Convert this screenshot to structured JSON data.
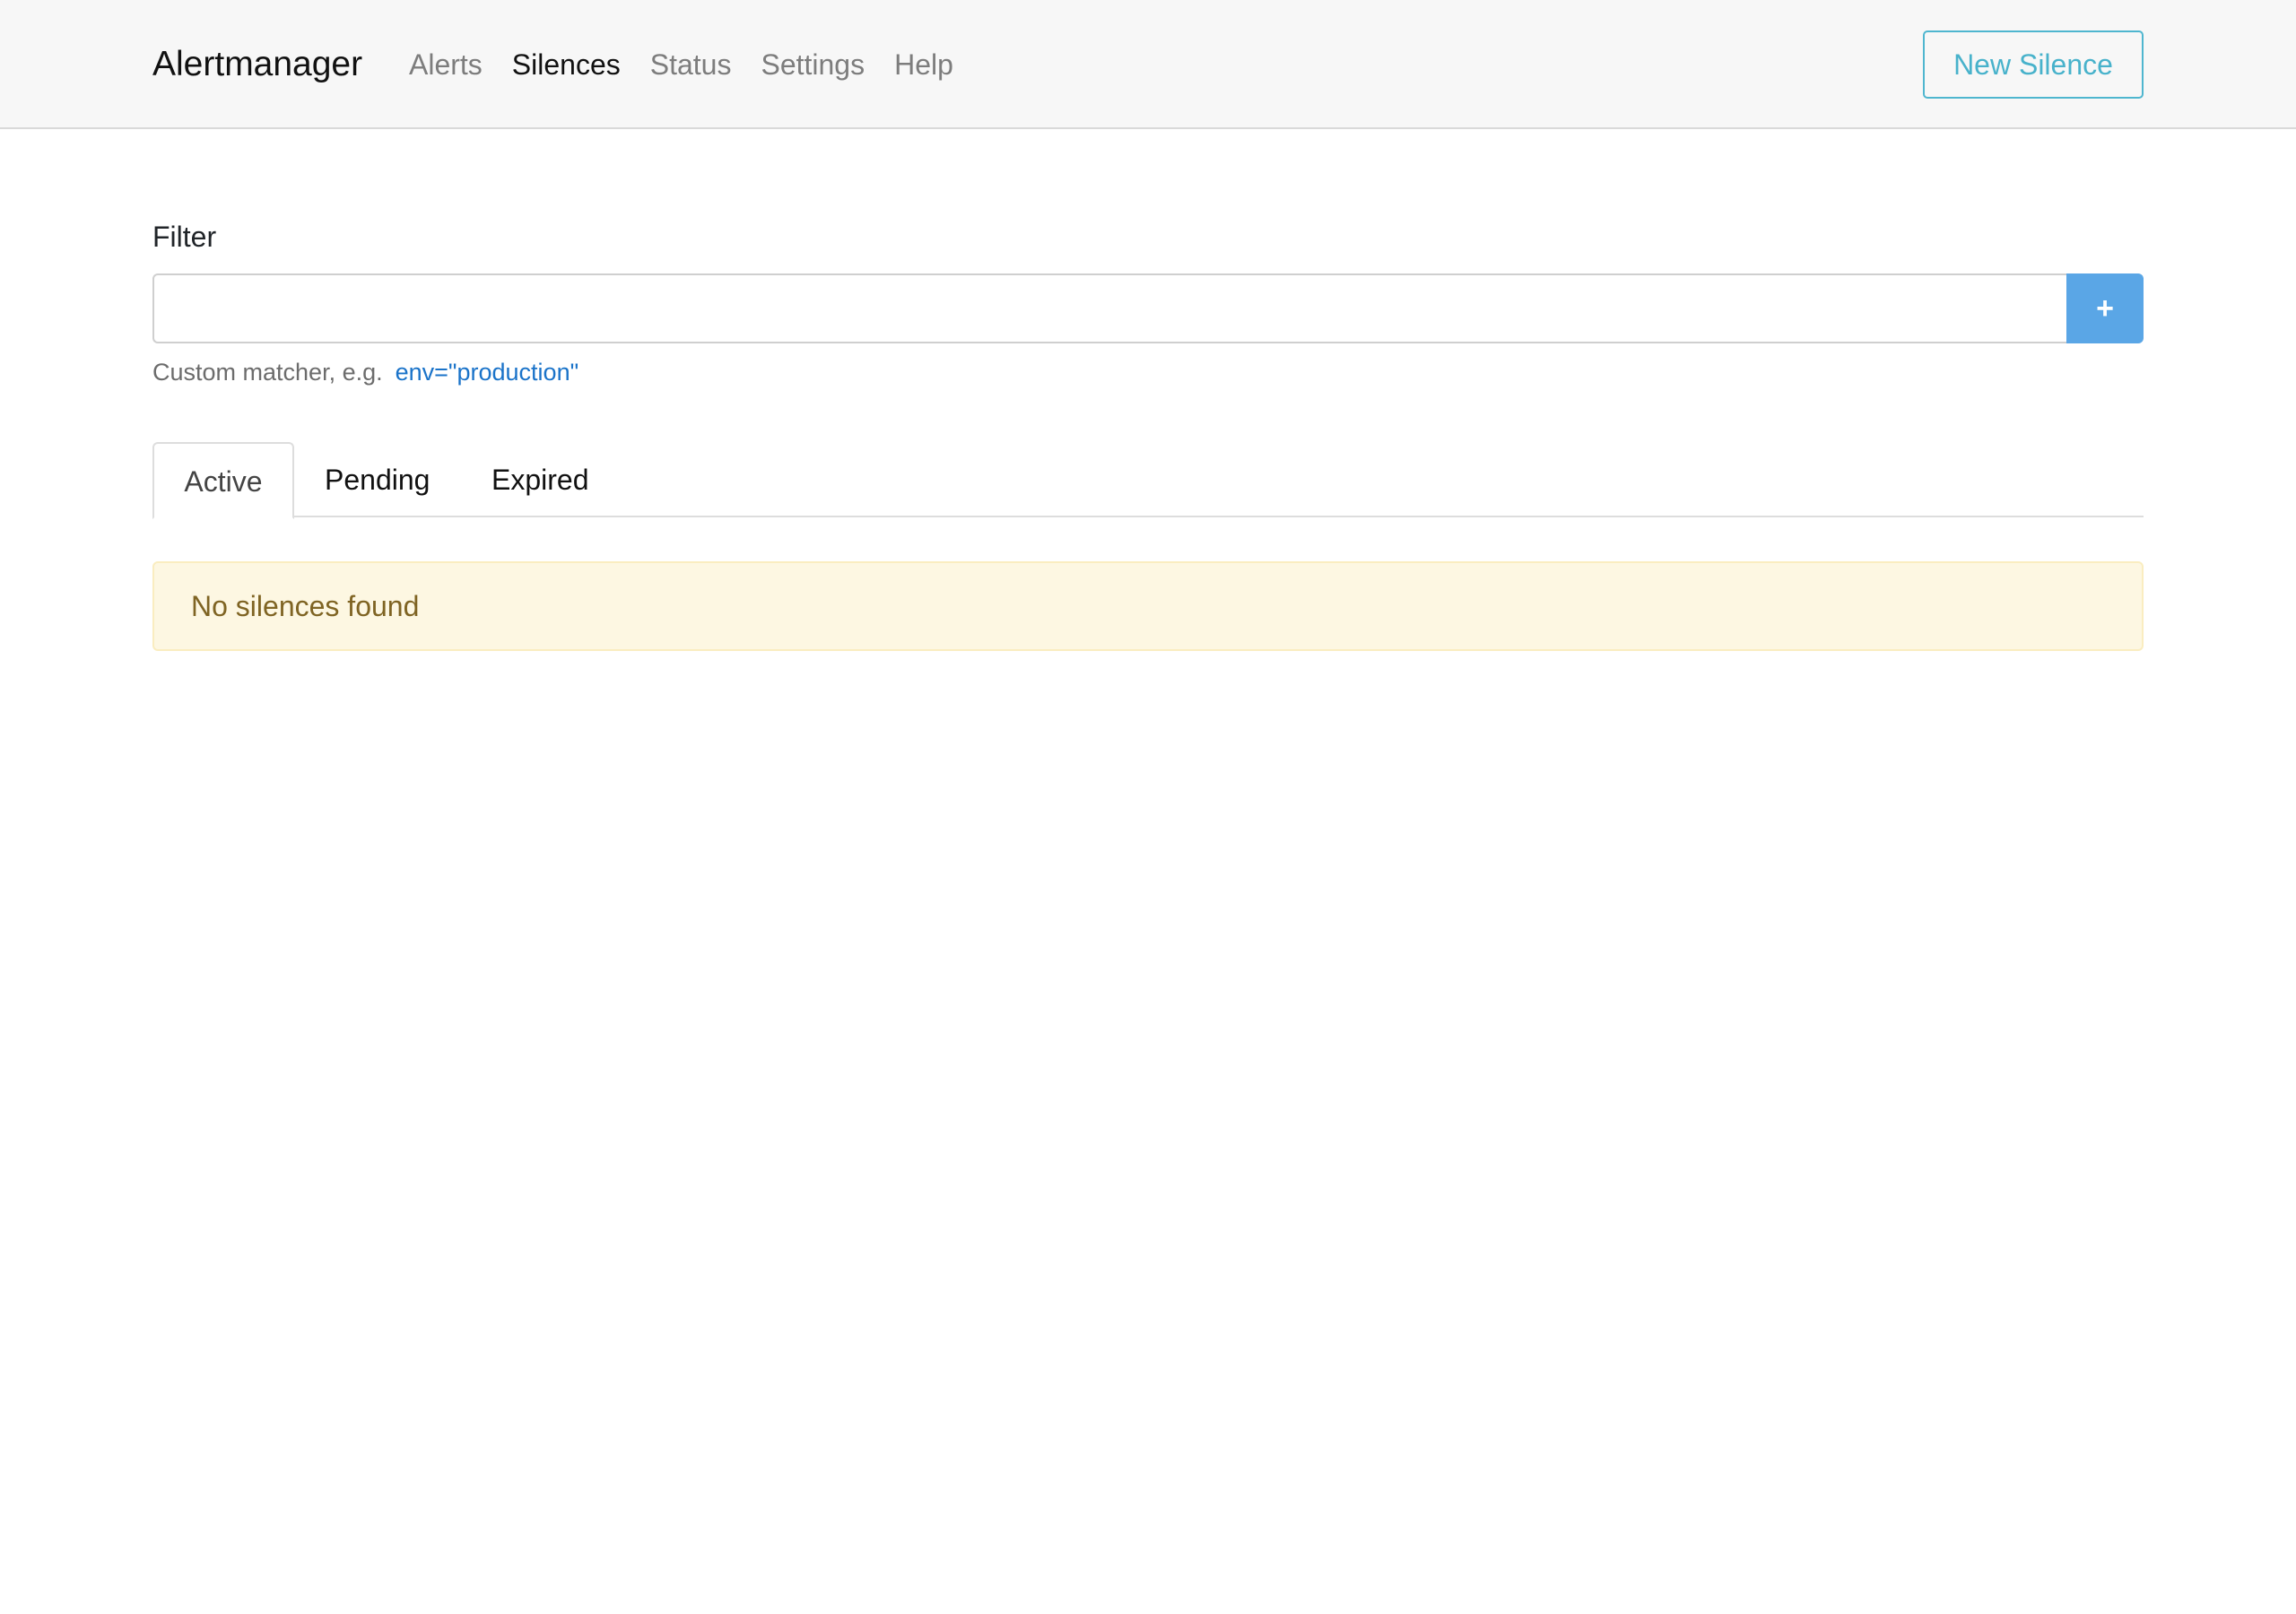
{
  "navbar": {
    "brand": "Alertmanager",
    "links": [
      {
        "label": "Alerts",
        "active": false
      },
      {
        "label": "Silences",
        "active": true
      },
      {
        "label": "Status",
        "active": false
      },
      {
        "label": "Settings",
        "active": false
      },
      {
        "label": "Help",
        "active": false
      }
    ],
    "new_silence_label": "New Silence"
  },
  "filter": {
    "label": "Filter",
    "value": "",
    "add_button_label": "+",
    "hint_text": "Custom matcher, e.g.",
    "hint_example": "env=\"production\""
  },
  "tabs": [
    {
      "label": "Active",
      "active": true
    },
    {
      "label": "Pending",
      "active": false
    },
    {
      "label": "Expired",
      "active": false
    }
  ],
  "message": "No silences found",
  "colors": {
    "navbar_bg": "#f7f7f7",
    "new_silence_border": "#4fb6cf",
    "add_button_bg": "#5aa6e6",
    "hint_link": "#1a73c9",
    "alert_bg": "#fdf7e2",
    "alert_text": "#7f6423"
  }
}
